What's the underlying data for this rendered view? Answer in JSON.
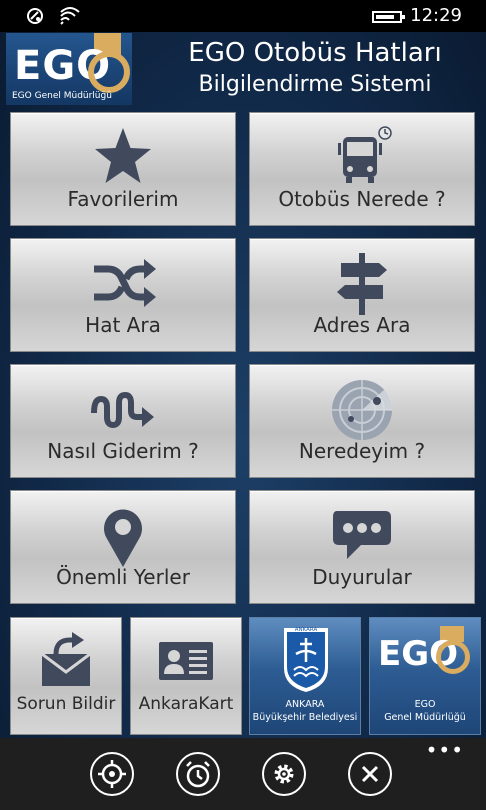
{
  "status_bar": {
    "time": "12:29",
    "battery_level": 0.8
  },
  "header": {
    "logo_text": "EGO",
    "logo_subtitle": "EGO Genel Müdürlüğü",
    "title_line1": "EGO Otobüs Hatları",
    "title_line2": "Bilgilendirme Sistemi"
  },
  "tiles": [
    {
      "label": "Favorilerim",
      "icon": "star-icon"
    },
    {
      "label": "Otobüs Nerede ?",
      "icon": "bus-clock-icon"
    },
    {
      "label": "Hat Ara",
      "icon": "shuffle-icon"
    },
    {
      "label": "Adres Ara",
      "icon": "signpost-icon"
    },
    {
      "label": "Nasıl Giderim ?",
      "icon": "route-arrow-icon"
    },
    {
      "label": "Neredeyim ?",
      "icon": "radar-icon"
    },
    {
      "label": "Önemli Yerler",
      "icon": "map-pin-icon"
    },
    {
      "label": "Duyurular",
      "icon": "speech-bubble-icon"
    }
  ],
  "small_tiles": [
    {
      "label": "Sorun Bildir",
      "icon": "mail-forward-icon"
    },
    {
      "label": "AnkaraKart",
      "icon": "id-card-icon"
    }
  ],
  "promos": {
    "ankara": {
      "logo_text": "ANKARA",
      "line1": "ANKARA",
      "line2": "Büyükşehir Belediyesi"
    },
    "ego": {
      "logo_text": "EGO",
      "line1": "EGO",
      "line2": "Genel Müdürlüğü"
    }
  },
  "app_bar": {
    "buttons": [
      "locate-icon",
      "alarm-clock-icon",
      "settings-icon",
      "close-icon"
    ],
    "more": "•••"
  },
  "colors": {
    "accent_gold": "#d9ac5f",
    "background": "#112a4a",
    "app_bar": "#1f1f1f"
  }
}
